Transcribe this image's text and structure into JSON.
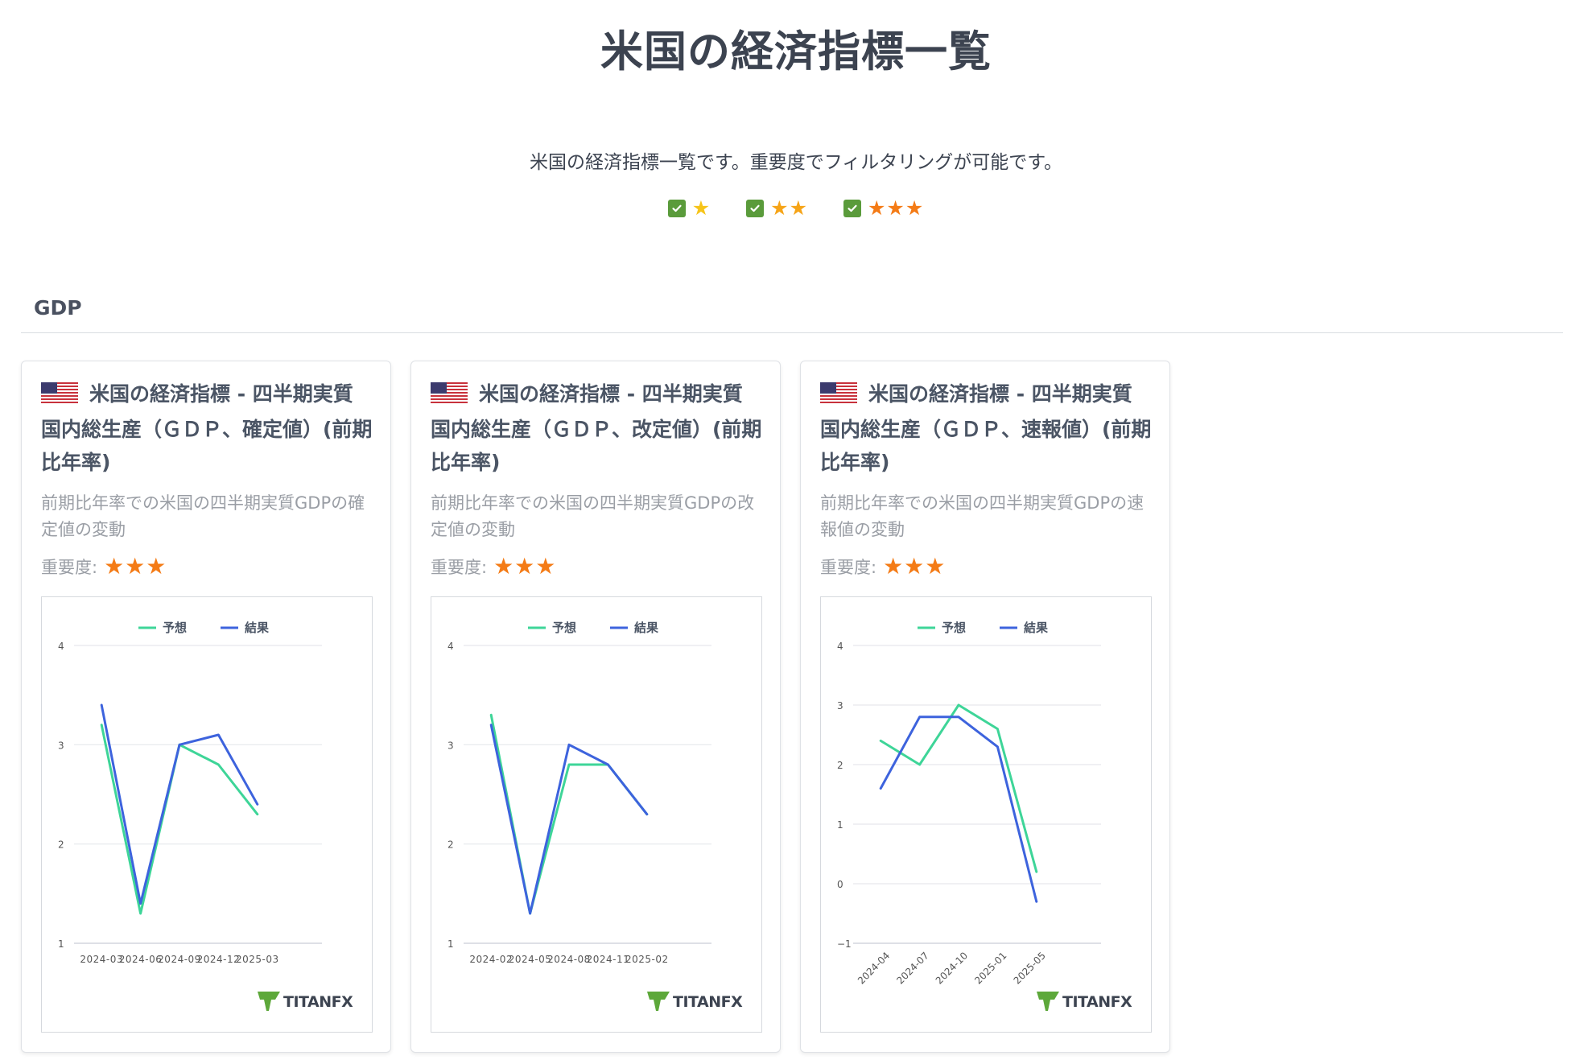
{
  "page": {
    "title": "米国の経済指標一覧",
    "description": "米国の経済指標一覧です。重要度でフィルタリングが可能です。"
  },
  "filters": [
    {
      "stars": "★",
      "star_color": "#f6c419",
      "checked": true
    },
    {
      "stars": "★★",
      "star_color": "#f6a417",
      "checked": true
    },
    {
      "stars": "★★★",
      "star_color": "#f47b16",
      "checked": true
    }
  ],
  "section": {
    "title": "GDP"
  },
  "colors": {
    "forecast": "#3ed598",
    "actual": "#3d63dd",
    "check": "#5a9b3b",
    "stars": "#f47b16"
  },
  "cards": [
    {
      "title": "米国の経済指標 - 四半期実質国内総生産（ＧＤＰ、確定値）(前期比年率)",
      "description": "前期比年率での米国の四半期実質GDPの確定値の変動",
      "importance_label": "重要度:",
      "importance_stars": "★★★",
      "logo": "TITANFX"
    },
    {
      "title": "米国の経済指標 - 四半期実質国内総生産（ＧＤＰ、改定値）(前期比年率)",
      "description": "前期比年率での米国の四半期実質GDPの改定値の変動",
      "importance_label": "重要度:",
      "importance_stars": "★★★",
      "logo": "TITANFX"
    },
    {
      "title": "米国の経済指標 - 四半期実質国内総生産（ＧＤＰ、速報値）(前期比年率)",
      "description": "前期比年率での米国の四半期実質GDPの速報値の変動",
      "importance_label": "重要度:",
      "importance_stars": "★★★",
      "logo": "TITANFX"
    }
  ],
  "chart_data": [
    {
      "type": "line",
      "categories": [
        "2024-03",
        "2024-06",
        "2024-09",
        "2024-12",
        "2025-03"
      ],
      "series": [
        {
          "name": "予想",
          "values": [
            3.2,
            1.3,
            3.0,
            2.8,
            2.3
          ]
        },
        {
          "name": "結果",
          "values": [
            3.4,
            1.4,
            3.0,
            3.1,
            2.4
          ]
        }
      ],
      "ylim": [
        1,
        4
      ],
      "yticks": [
        1,
        2,
        3,
        4
      ],
      "legend": "top-center",
      "grid": true,
      "rotate_labels": false
    },
    {
      "type": "line",
      "categories": [
        "2024-02",
        "2024-05",
        "2024-08",
        "2024-11",
        "2025-02"
      ],
      "series": [
        {
          "name": "予想",
          "values": [
            3.3,
            1.3,
            2.8,
            2.8,
            2.3
          ]
        },
        {
          "name": "結果",
          "values": [
            3.2,
            1.3,
            3.0,
            2.8,
            2.3
          ]
        }
      ],
      "ylim": [
        1,
        4
      ],
      "yticks": [
        1,
        2,
        3,
        4
      ],
      "legend": "top-center",
      "grid": true,
      "rotate_labels": false
    },
    {
      "type": "line",
      "categories": [
        "2024-04",
        "2024-07",
        "2024-10",
        "2025-01",
        "2025-05"
      ],
      "series": [
        {
          "name": "予想",
          "values": [
            2.4,
            2.0,
            3.0,
            2.6,
            0.2
          ]
        },
        {
          "name": "結果",
          "values": [
            1.6,
            2.8,
            2.8,
            2.3,
            -0.3
          ]
        }
      ],
      "ylim": [
        -1,
        4
      ],
      "yticks": [
        -1,
        0,
        1,
        2,
        3,
        4
      ],
      "legend": "top-center",
      "grid": true,
      "rotate_labels": true
    }
  ]
}
